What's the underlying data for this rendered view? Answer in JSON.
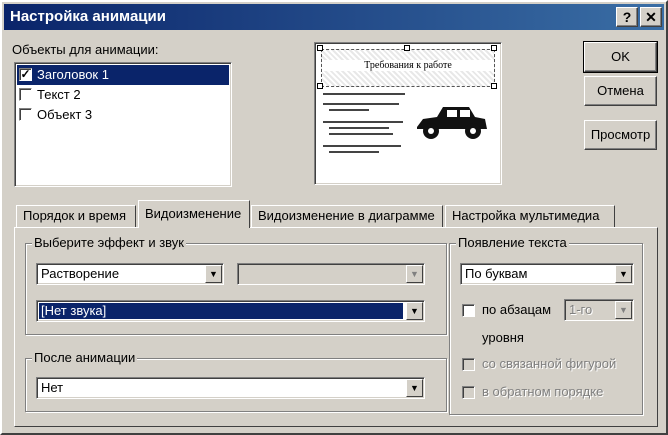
{
  "window": {
    "title": "Настройка анимации",
    "help_label": "?",
    "close_label": "✕"
  },
  "objects": {
    "label": "Объекты для анимации:",
    "items": [
      {
        "label": "Заголовок 1",
        "checked": true,
        "selected": true
      },
      {
        "label": "Текст 2",
        "checked": false,
        "selected": false
      },
      {
        "label": "Объект 3",
        "checked": false,
        "selected": false
      }
    ]
  },
  "preview": {
    "slide_title": "Требования к работе",
    "bullets": [
      "",
      "",
      "",
      ""
    ]
  },
  "buttons": {
    "ok": "OK",
    "cancel": "Отмена",
    "preview": "Просмотр"
  },
  "tabs": [
    {
      "label": "Порядок и время",
      "active": false
    },
    {
      "label": "Видоизменение",
      "active": true
    },
    {
      "label": "Видоизменение в диаграмме",
      "active": false
    },
    {
      "label": "Настройка мультимедиа",
      "active": false
    }
  ],
  "effect": {
    "group_label": "Выберите эффект и звук",
    "effect_value": "Растворение",
    "direction_value": "",
    "sound_value": "[Нет звука]"
  },
  "after": {
    "group_label": "После анимации",
    "value": "Нет"
  },
  "text_appearance": {
    "group_label": "Появление текста",
    "mode_value": "По буквам",
    "by_paragraph_label": "по абзацам",
    "level_value": "1-го",
    "level_suffix": "уровня",
    "attached_shape_label": "со связанной фигурой",
    "reverse_order_label": "в обратном порядке"
  }
}
